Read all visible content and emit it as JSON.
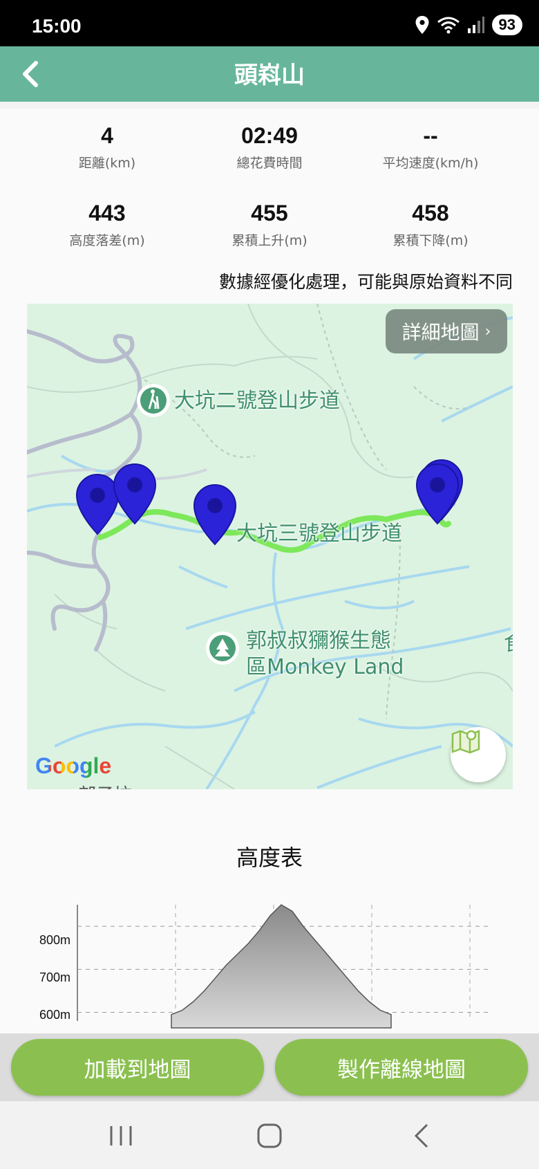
{
  "status": {
    "time": "15:00",
    "battery": "93"
  },
  "header": {
    "title": "頭嵙山"
  },
  "stats": [
    {
      "value": "4",
      "label": "距離(km)"
    },
    {
      "value": "02:49",
      "label": "總花費時間"
    },
    {
      "value": "--",
      "label": "平均速度(km/h)"
    },
    {
      "value": "443",
      "label": "高度落差(m)"
    },
    {
      "value": "455",
      "label": "累積上升(m)"
    },
    {
      "value": "458",
      "label": "累積下降(m)"
    }
  ],
  "note": "數據經優化處理，可能與原始資料不同",
  "map": {
    "detail_button": "詳細地圖",
    "poi": [
      {
        "name": "大坑二號登山步道"
      },
      {
        "name": "大坑三號登山步道"
      },
      {
        "name": "郭叔叔獼猴生態"
      },
      {
        "name": "區Monkey Land"
      }
    ],
    "edge_text": "食",
    "bottom_text": "部子坑",
    "attribution": "Google",
    "colors": {
      "route": "#7de85a",
      "marker": "#2a23d8",
      "water": "#a8d8f0",
      "road": "#b7bccd",
      "poi": "#4b9e78"
    }
  },
  "elevation": {
    "title": "高度表",
    "chart_data": {
      "type": "area",
      "yticks": [
        "800m",
        "700m",
        "600m"
      ],
      "ylim": [
        580,
        850
      ],
      "x": [
        0,
        0.05,
        0.1,
        0.15,
        0.2,
        0.25,
        0.3,
        0.35,
        0.4,
        0.45,
        0.5,
        0.55,
        0.6,
        0.65,
        0.7,
        0.75,
        0.8,
        0.85,
        0.9,
        0.95,
        1.0
      ],
      "values": [
        595,
        605,
        625,
        650,
        680,
        710,
        735,
        760,
        790,
        825,
        850,
        835,
        800,
        770,
        740,
        710,
        680,
        650,
        625,
        605,
        595
      ],
      "grid": true
    }
  },
  "actions": {
    "load_map": "加載到地圖",
    "offline_map": "製作離線地圖"
  }
}
